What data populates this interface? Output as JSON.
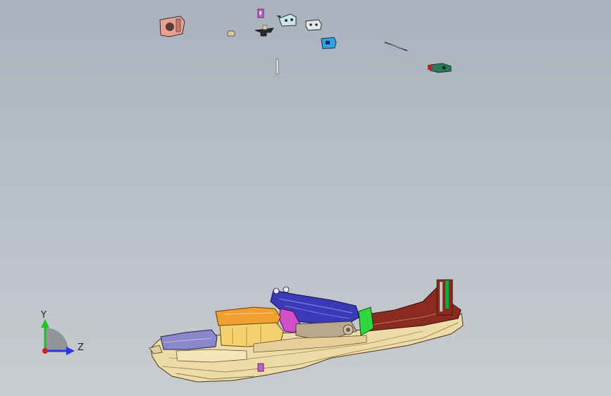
{
  "viewport": {
    "background_top": "#a9b2bd",
    "background_bottom": "#c9ccd0"
  },
  "triad": {
    "y_label": "Y",
    "z_label": "Z",
    "y_color": "#1fbf2a",
    "z_color": "#2a38e0",
    "x_color": "#d42020"
  },
  "exploded_parts": [
    {
      "name": "bracket-salmon",
      "color": "#e8a090"
    },
    {
      "name": "clip-small-tan",
      "color": "#e6c79a"
    },
    {
      "name": "fastener-magenta",
      "color": "#c060d0"
    },
    {
      "name": "clip-dark-black",
      "color": "#2a2a2a"
    },
    {
      "name": "bracket-light-teal",
      "color": "#cfe4e4"
    },
    {
      "name": "bracket-light-gray",
      "color": "#e4e8ea"
    },
    {
      "name": "bracket-blue",
      "color": "#36a0e0"
    },
    {
      "name": "rod-thin",
      "color": "#3a3a3a"
    },
    {
      "name": "pin-thin-vertical",
      "color": "#f0f0f0"
    },
    {
      "name": "connector-green-red",
      "color": "#2a7a5a"
    }
  ],
  "assembly": {
    "main_tray_color": "#eedca8",
    "orange_tank_color": "#f0a030",
    "blue_frame_color": "#3a3ab8",
    "magenta_part_color": "#d050c8",
    "green_panel_color": "#30d840",
    "brown_tray_color": "#8a2a20",
    "purple_block_color": "#8a88c8"
  }
}
